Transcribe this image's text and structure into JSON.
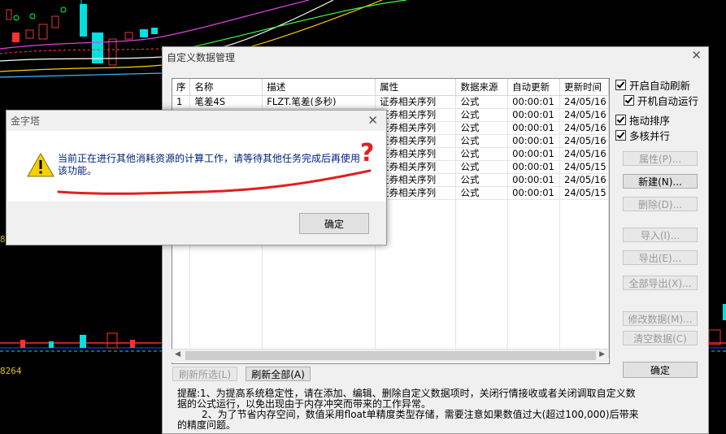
{
  "side_values": {
    "mid": "8",
    "bottom": "8264"
  },
  "main_dialog": {
    "title": "自定义数据管理",
    "columns": [
      "序",
      "名称",
      "描述",
      "属性",
      "数据来源",
      "自动更新",
      "更新时间"
    ],
    "rows": [
      [
        "1",
        "笔差4S",
        "FLZT.笔差(多秒)",
        "证券相关序列",
        "公式",
        "00:00:01",
        "24/05/16"
      ],
      [
        "",
        "",
        "",
        "证券相关序列",
        "公式",
        "00:00:01",
        "24/05/16"
      ],
      [
        "",
        "",
        "",
        "证券相关序列",
        "公式",
        "00:00:01",
        "24/05/16"
      ],
      [
        "",
        "",
        "",
        "证券相关序列",
        "公式",
        "00:00:01",
        "24/05/16"
      ],
      [
        "",
        "",
        "",
        "证券相关序列",
        "公式",
        "00:00:01",
        "24/05/16"
      ],
      [
        "",
        "",
        "",
        "证券相关序列",
        "公式",
        "00:00:01",
        "24/05/15"
      ],
      [
        "",
        "",
        "",
        "证券相关序列",
        "公式",
        "00:00:01",
        "24/05/16"
      ],
      [
        "",
        "",
        "",
        "证券相关序列",
        "公式",
        "00:00:01",
        "24/05/15"
      ]
    ],
    "checkboxes": {
      "auto_refresh": "开启自动刷新",
      "startup_auto_run": "开机自动运行",
      "drag_sort": "拖动排序",
      "multicore": "多核并行"
    },
    "buttons": {
      "properties": "属性(P)...",
      "new": "新建(N)...",
      "delete": "删除(D)...",
      "import": "导入(I)...",
      "export": "导出(E)...",
      "export_all": "全部导出(X)...",
      "modify_data": "修改数据(M)...",
      "clear_data": "清空数据(C)",
      "ok": "确定",
      "refresh_selected": "刷新所选(L)",
      "refresh_all": "刷新全部(A)"
    },
    "tips": {
      "line1": "提醒:1、为提高系统稳定性，请在添加、编辑、删除自定义数据项时，关闭行情接收或者关闭调取自定义数",
      "line2": "据的公式运行，以免出现由于内存冲突而带来的工作异常。",
      "line3": "2、为了节省内存空间，数值采用float单精度类型存储，需要注意如果数值过大(超过100,000)后带来",
      "line4": "的精度问题。"
    }
  },
  "alert_dialog": {
    "title": "金字塔",
    "message": "当前正在进行其他消耗资源的计算工作，请等待其他任务完成后再使用该功能。",
    "ok": "确定"
  },
  "annotation": {
    "mark": "?",
    "color": "#e02020"
  },
  "colors": {
    "background": "#000000",
    "dialog": "#f0f0f0",
    "message_text": "#00227a",
    "side_values": "#e0c020"
  }
}
